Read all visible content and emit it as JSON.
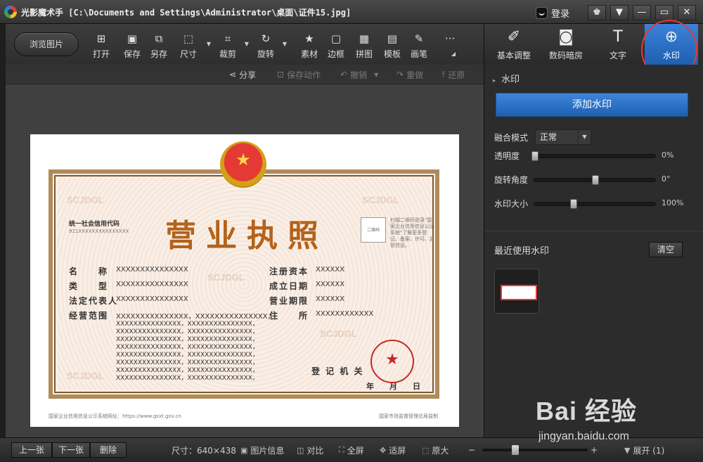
{
  "window": {
    "title": "光影魔术手 [C:\\Documents and Settings\\Administrator\\桌面\\证件15.jpg]",
    "login": "登录",
    "buttons": {
      "skin": "♚",
      "menu": "▼",
      "minimize": "—",
      "maximize": "▭",
      "close": "✕"
    }
  },
  "toolbar": {
    "browse": "浏览图片",
    "tools": [
      {
        "label": "打开",
        "icon": "open-icon",
        "glyph": "⊞"
      },
      {
        "label": "保存",
        "icon": "save-icon",
        "glyph": "▣"
      },
      {
        "label": "另存",
        "icon": "save-as-icon",
        "glyph": "⧉"
      },
      {
        "label": "尺寸",
        "icon": "resize-icon",
        "glyph": "⬚"
      },
      {
        "label": "裁剪",
        "icon": "crop-icon",
        "glyph": "⌗"
      },
      {
        "label": "旋转",
        "icon": "rotate-icon",
        "glyph": "↻"
      },
      {
        "label": "素材",
        "icon": "material-icon",
        "glyph": "★"
      },
      {
        "label": "边框",
        "icon": "border-icon",
        "glyph": "▢"
      },
      {
        "label": "拼图",
        "icon": "collage-icon",
        "glyph": "▦"
      },
      {
        "label": "模板",
        "icon": "template-icon",
        "glyph": "▤"
      },
      {
        "label": "画笔",
        "icon": "brush-icon",
        "glyph": "✎"
      },
      {
        "label": "",
        "icon": "more-icon",
        "glyph": "···"
      }
    ],
    "expand_glyph": "◢"
  },
  "panel_tabs": [
    {
      "label": "基本调整",
      "icon": "adjust-icon",
      "glyph": "✐"
    },
    {
      "label": "数码暗房",
      "icon": "darkroom-icon",
      "glyph": "◙"
    },
    {
      "label": "文字",
      "icon": "text-icon",
      "glyph": "T"
    },
    {
      "label": "水印",
      "icon": "watermark-icon",
      "glyph": "⊕"
    }
  ],
  "subbar": {
    "share": "分享",
    "save_action": "保存动作",
    "undo": "撤销",
    "redo": "重做",
    "restore": "还原"
  },
  "certificate": {
    "title": "营业执照",
    "credit_label": "统一社会信用代码",
    "credit_value": "911XXXXXXXXXXXXXXX",
    "qr_text": "二维码",
    "qr_note": "扫描二维码登录\"国家企业信用信息公示系统\"了解更多登记、备案、许可、监管信息。",
    "fields_left": [
      {
        "label": "名　　称",
        "value": "XXXXXXXXXXXXXXX"
      },
      {
        "label": "类　　型",
        "value": "XXXXXXXXXXXXXXX"
      },
      {
        "label": "法定代表人",
        "value": "XXXXXXXXXXXXXXX"
      },
      {
        "label": "经营范围",
        "value": "XXXXXXXXXXXXXXX，XXXXXXXXXXXXXXX，"
      }
    ],
    "scope_lines": [
      "XXXXXXXXXXXXXXX，XXXXXXXXXXXXXXX，",
      "XXXXXXXXXXXXXXX，XXXXXXXXXXXXXXX，",
      "XXXXXXXXXXXXXXX，XXXXXXXXXXXXXXX，",
      "XXXXXXXXXXXXXXX，XXXXXXXXXXXXXXX，",
      "XXXXXXXXXXXXXXX，XXXXXXXXXXXXXXX，",
      "XXXXXXXXXXXXXXX，XXXXXXXXXXXXXXX，",
      "XXXXXXXXXXXXXXX，XXXXXXXXXXXXXXX，",
      "XXXXXXXXXXXXXXX，XXXXXXXXXXXXXXX，"
    ],
    "fields_right": [
      {
        "label": "注册资本",
        "value": "XXXXXX"
      },
      {
        "label": "成立日期",
        "value": "XXXXXX"
      },
      {
        "label": "营业期限",
        "value": "XXXXXX"
      },
      {
        "label": "住　　所",
        "value": "XXXXXXXXXXXX"
      }
    ],
    "authority": "登 记 机 关",
    "date": "年　　月　　日",
    "footer_left": "国家企业信用信息公示系统网址：https://www.gsxt.gov.cn",
    "footer_right": "国家市场监督管理总局监制",
    "watermark": "SCJDGL"
  },
  "panel": {
    "heading": "水印",
    "add_button": "添加水印",
    "blend_label": "融合模式",
    "blend_value": "正常",
    "sliders": [
      {
        "label": "透明度",
        "value": "0%",
        "fraction": 0.0
      },
      {
        "label": "旋转角度",
        "value": "0°",
        "fraction": 0.5
      },
      {
        "label": "水印大小",
        "value": "100%",
        "fraction": 0.32
      }
    ],
    "recent_label": "最近使用水印",
    "clear": "清空"
  },
  "statusbar": {
    "prev": "上一张",
    "next": "下一张",
    "delete": "删除",
    "size": "尺寸：640×438",
    "info": "图片信息",
    "compare": "对比",
    "fullscreen": "全屏",
    "fit": "适屏",
    "original": "原大",
    "minus": "−",
    "plus": "+",
    "expand": "展开 (1)",
    "zoom_fraction": 0.31
  },
  "overlay": {
    "baidu_word": "Bai 经验",
    "baidu_url": "jingyan.baidu.com"
  }
}
